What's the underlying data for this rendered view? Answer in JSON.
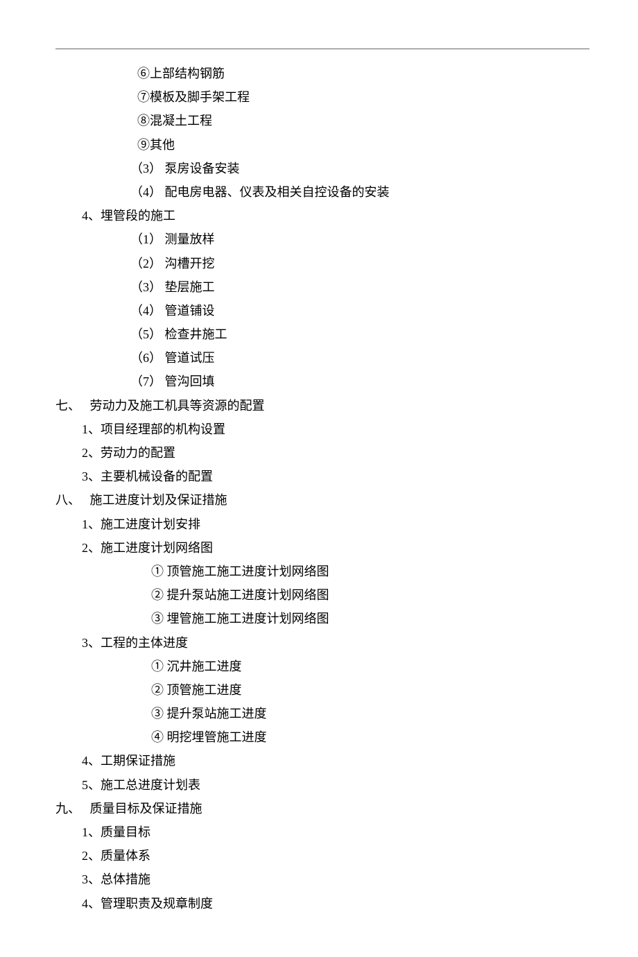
{
  "lines": [
    {
      "indent": 3,
      "text": "⑥上部结构钢筋"
    },
    {
      "indent": 3,
      "text": "⑦模板及脚手架工程"
    },
    {
      "indent": 3,
      "text": "⑧混凝土工程"
    },
    {
      "indent": 3,
      "text": "⑨其他"
    },
    {
      "indent": 2,
      "text": "（3） 泵房设备安装"
    },
    {
      "indent": 2,
      "text": "（4） 配电房电器、仪表及相关自控设备的安装"
    },
    {
      "indent": 1,
      "text": "4、埋管段的施工"
    },
    {
      "indent": 2,
      "text": "（1） 测量放样"
    },
    {
      "indent": 2,
      "text": "（2） 沟槽开挖"
    },
    {
      "indent": 2,
      "text": "（3） 垫层施工"
    },
    {
      "indent": 2,
      "text": "（4） 管道铺设"
    },
    {
      "indent": 2,
      "text": "（5） 检查井施工"
    },
    {
      "indent": 2,
      "text": "（6） 管道试压"
    },
    {
      "indent": 2,
      "text": "（7） 管沟回填"
    },
    {
      "indent": 0,
      "text": "七、   劳动力及施工机具等资源的配置"
    },
    {
      "indent": 1,
      "text": "1、项目经理部的机构设置"
    },
    {
      "indent": 1,
      "text": "2、劳动力的配置"
    },
    {
      "indent": 1,
      "text": "3、主要机械设备的配置"
    },
    {
      "indent": 0,
      "text": "八、   施工进度计划及保证措施"
    },
    {
      "indent": 1,
      "text": "1、施工进度计划安排"
    },
    {
      "indent": 1,
      "text": "2、施工进度计划网络图"
    },
    {
      "indent": 4,
      "text": "① 顶管施工施工进度计划网络图"
    },
    {
      "indent": 4,
      "text": "② 提升泵站施工进度计划网络图"
    },
    {
      "indent": 4,
      "text": "③ 埋管施工施工进度计划网络图"
    },
    {
      "indent": 1,
      "text": "3、工程的主体进度"
    },
    {
      "indent": 4,
      "text": "① 沉井施工进度"
    },
    {
      "indent": 4,
      "text": "② 顶管施工进度"
    },
    {
      "indent": 4,
      "text": "③ 提升泵站施工进度"
    },
    {
      "indent": 4,
      "text": "④ 明挖埋管施工进度"
    },
    {
      "indent": 1,
      "text": "4、工期保证措施"
    },
    {
      "indent": 1,
      "text": "5、施工总进度计划表"
    },
    {
      "indent": 0,
      "text": "九、   质量目标及保证措施"
    },
    {
      "indent": 1,
      "text": "1、质量目标"
    },
    {
      "indent": 1,
      "text": "2、质量体系"
    },
    {
      "indent": 1,
      "text": "3、总体措施"
    },
    {
      "indent": 1,
      "text": "4、管理职责及规章制度"
    }
  ]
}
